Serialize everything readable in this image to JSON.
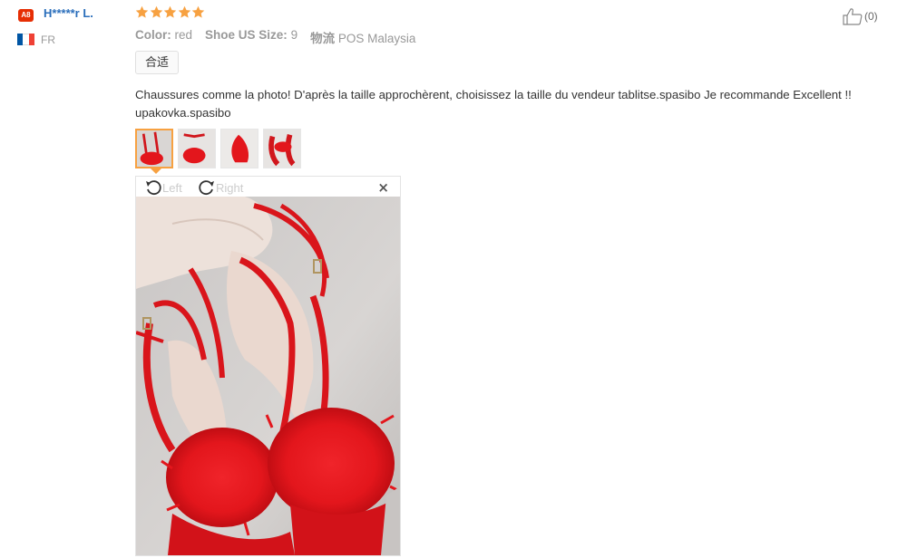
{
  "buyer": {
    "badge": "A8",
    "name": "H*****r L.",
    "country": "FR",
    "flag_colors": [
      "#0055a4",
      "#ffffff",
      "#ef4135"
    ]
  },
  "rating": {
    "stars": 5,
    "max": 5,
    "color": "#f7a141"
  },
  "attributes": {
    "color_label": "Color:",
    "color_value": "red",
    "size_label": "Shoe US Size:",
    "size_value": "9",
    "logistics_label": "物流",
    "logistics_value": "POS Malaysia"
  },
  "tag": "合适",
  "review_text": "Chaussures comme la photo! D'après la taille approchèrent, choisissez la taille du vendeur tablitse.spasibo Je recommande Excellent !! upakovka.spasibo",
  "helpful": {
    "icon": "thumbs-up-icon",
    "count": "(0)"
  },
  "thumbnails": [
    {
      "name": "photo-1",
      "active": true
    },
    {
      "name": "photo-2",
      "active": false
    },
    {
      "name": "photo-3",
      "active": false
    },
    {
      "name": "photo-4",
      "active": false
    }
  ],
  "viewer": {
    "rotate_left": "Left",
    "rotate_right": "Right",
    "close": "×"
  },
  "colors": {
    "link": "#2a6ebb",
    "accent": "#f7a141",
    "brand": "#e62e04",
    "shoe": "#e3161c"
  }
}
